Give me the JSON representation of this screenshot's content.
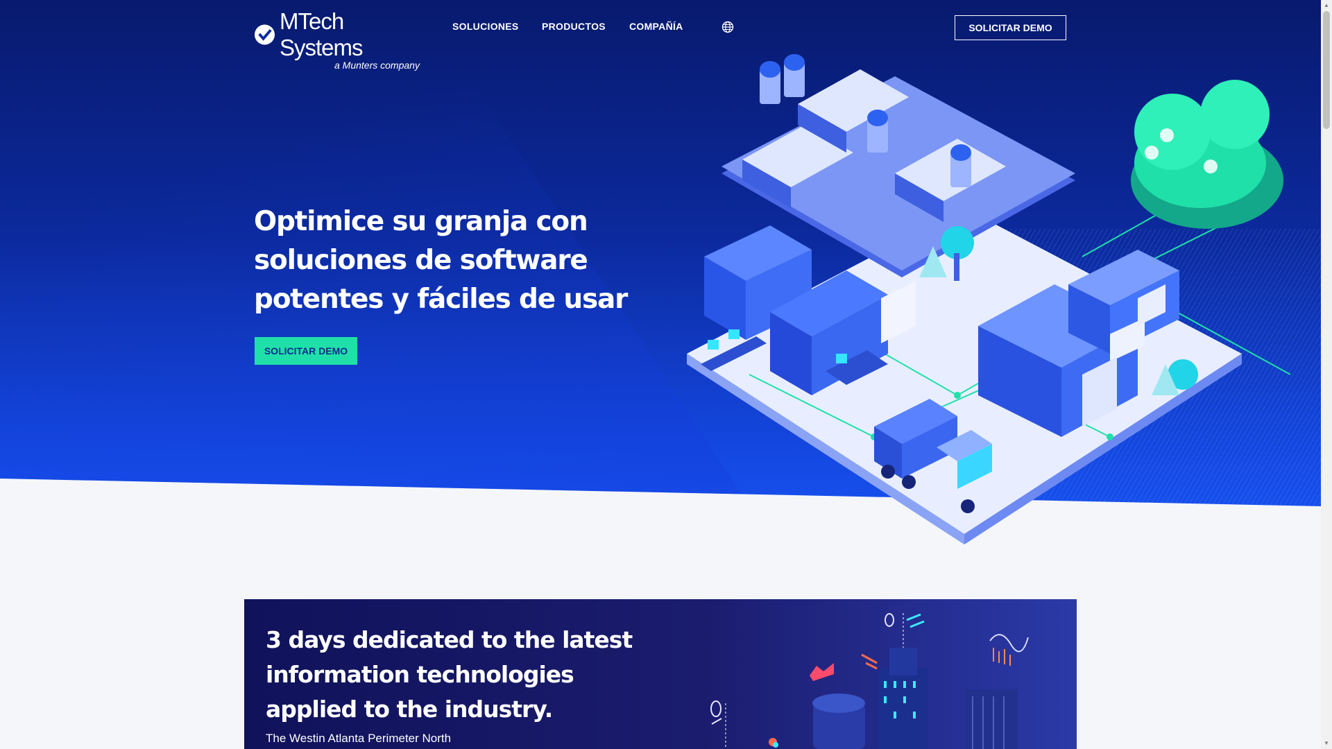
{
  "brand": {
    "name": "MTech Systems",
    "tagline": "a Munters company"
  },
  "nav": {
    "items": [
      {
        "label": "SOLUCIONES"
      },
      {
        "label": "PRODUCTOS"
      },
      {
        "label": "COMPAÑÍA"
      }
    ],
    "language_icon": "globe-icon",
    "cta_label": "SOLICITAR DEMO"
  },
  "hero": {
    "title": "Optimice su granja con soluciones de software potentes y fáciles de usar",
    "cta_label": "SOLICITAR DEMO"
  },
  "event": {
    "title": "3 days dedicated to the latest information technologies applied to the industry.",
    "location": "The Westin Atlanta Perimeter North"
  },
  "colors": {
    "hero_dark": "#081a6e",
    "hero_bright": "#1a5bff",
    "accent_green": "#1fe0a8",
    "page_bg": "#f5f6f9",
    "event_bg": "#10125a"
  }
}
